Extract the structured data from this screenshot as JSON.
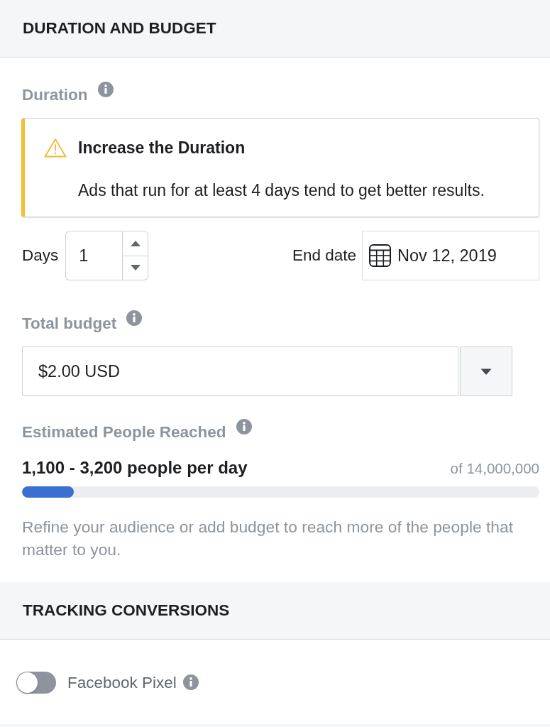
{
  "duration_and_budget": {
    "title": "DURATION AND BUDGET",
    "duration": {
      "label": "Duration"
    },
    "alert": {
      "title": "Increase the Duration",
      "text": "Ads that run for at least 4 days tend to get better results."
    },
    "days": {
      "label": "Days",
      "value": "1"
    },
    "end_date": {
      "label": "End date",
      "value": "Nov 12, 2019"
    },
    "total_budget": {
      "label": "Total budget",
      "value": "$2.00 USD"
    },
    "reach": {
      "label": "Estimated People Reached",
      "estimate": "1,100 - 3,200 people per day",
      "total": "of 14,000,000",
      "level": 0.1,
      "hint": "Refine your audience or add budget to reach more of the people that matter to you."
    }
  },
  "tracking_conversions": {
    "title": "TRACKING CONVERSIONS",
    "pixel": {
      "label": "Facebook Pixel",
      "on": false
    }
  }
}
